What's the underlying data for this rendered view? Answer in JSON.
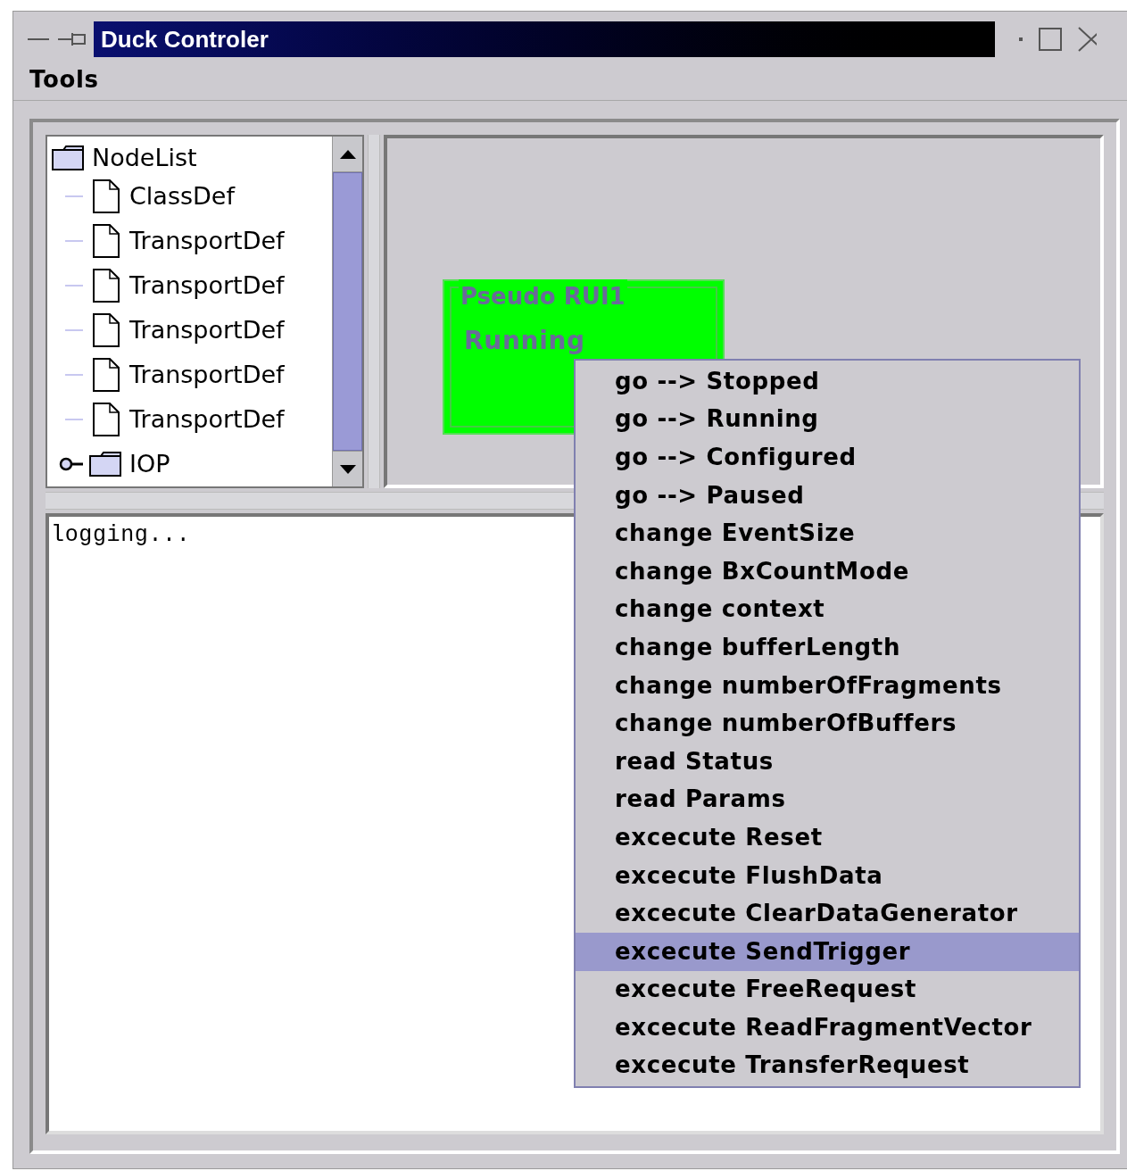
{
  "window": {
    "title": "Duck Controler"
  },
  "menu_bar": [
    "Tools"
  ],
  "tree": {
    "label": "NodeList",
    "children": [
      {
        "label": "ClassDef",
        "kind": "file"
      },
      {
        "label": "TransportDef",
        "kind": "file"
      },
      {
        "label": "TransportDef",
        "kind": "file"
      },
      {
        "label": "TransportDef",
        "kind": "file"
      },
      {
        "label": "TransportDef",
        "kind": "file"
      },
      {
        "label": "TransportDef",
        "kind": "file"
      },
      {
        "label": "IOP",
        "kind": "folder",
        "expanded": false
      }
    ]
  },
  "canvas": {
    "nodes": [
      {
        "title": "Pseudo RUI1",
        "state": "Running"
      }
    ]
  },
  "log": {
    "text": "logging..."
  },
  "context_menu": {
    "items": [
      {
        "label": "go --> Stopped",
        "selected": false
      },
      {
        "label": "go --> Running",
        "selected": false
      },
      {
        "label": "go --> Configured",
        "selected": false
      },
      {
        "label": "go --> Paused",
        "selected": false
      },
      {
        "label": "change EventSize",
        "selected": false
      },
      {
        "label": "change BxCountMode",
        "selected": false
      },
      {
        "label": "change context",
        "selected": false
      },
      {
        "label": "change bufferLength",
        "selected": false
      },
      {
        "label": "change numberOfFragments",
        "selected": false
      },
      {
        "label": "change numberOfBuffers",
        "selected": false
      },
      {
        "label": "read Status",
        "selected": false
      },
      {
        "label": "read Params",
        "selected": false
      },
      {
        "label": "excecute Reset",
        "selected": false
      },
      {
        "label": "excecute FlushData",
        "selected": false
      },
      {
        "label": "excecute ClearDataGenerator",
        "selected": false
      },
      {
        "label": "excecute SendTrigger",
        "selected": true
      },
      {
        "label": "excecute FreeRequest",
        "selected": false
      },
      {
        "label": "excecute ReadFragmentVector",
        "selected": false
      },
      {
        "label": "excecute TransferRequest",
        "selected": false
      }
    ]
  }
}
